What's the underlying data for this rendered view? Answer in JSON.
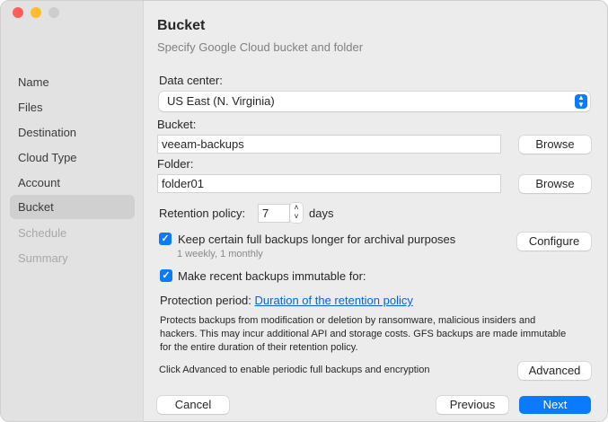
{
  "sidebar": {
    "items": [
      {
        "label": "Name"
      },
      {
        "label": "Files"
      },
      {
        "label": "Destination"
      },
      {
        "label": "Cloud Type"
      },
      {
        "label": "Account"
      },
      {
        "label": "Bucket"
      },
      {
        "label": "Schedule"
      },
      {
        "label": "Summary"
      }
    ]
  },
  "header": {
    "title": "Bucket",
    "subtitle": "Specify Google Cloud bucket and folder"
  },
  "form": {
    "data_center_label": "Data center:",
    "data_center_value": "US East (N. Virginia)",
    "bucket_label": "Bucket:",
    "bucket_value": "veeam-backups",
    "browse_label": "Browse",
    "folder_label": "Folder:",
    "folder_value": "folder01",
    "retention_label": "Retention policy:",
    "retention_value": "7",
    "retention_unit": "days",
    "keep_full_label": "Keep certain full backups longer for archival purposes",
    "keep_full_checked": true,
    "keep_full_detail": "1 weekly, 1 monthly",
    "configure_label": "Configure",
    "immutable_label": "Make recent backups immutable for:",
    "immutable_checked": true,
    "protection_label": "Protection period:",
    "protection_link": "Duration of the retention policy",
    "description": "Protects backups from modification or deletion by ransomware, malicious insiders and hackers. This may incur additional API and storage costs. GFS backups are made immutable for the entire duration of their retention policy.",
    "advanced_hint": "Click Advanced to enable periodic full backups and encryption",
    "advanced_label": "Advanced"
  },
  "footer": {
    "cancel": "Cancel",
    "previous": "Previous",
    "next": "Next"
  },
  "colors": {
    "accent": "#0a7aff"
  }
}
